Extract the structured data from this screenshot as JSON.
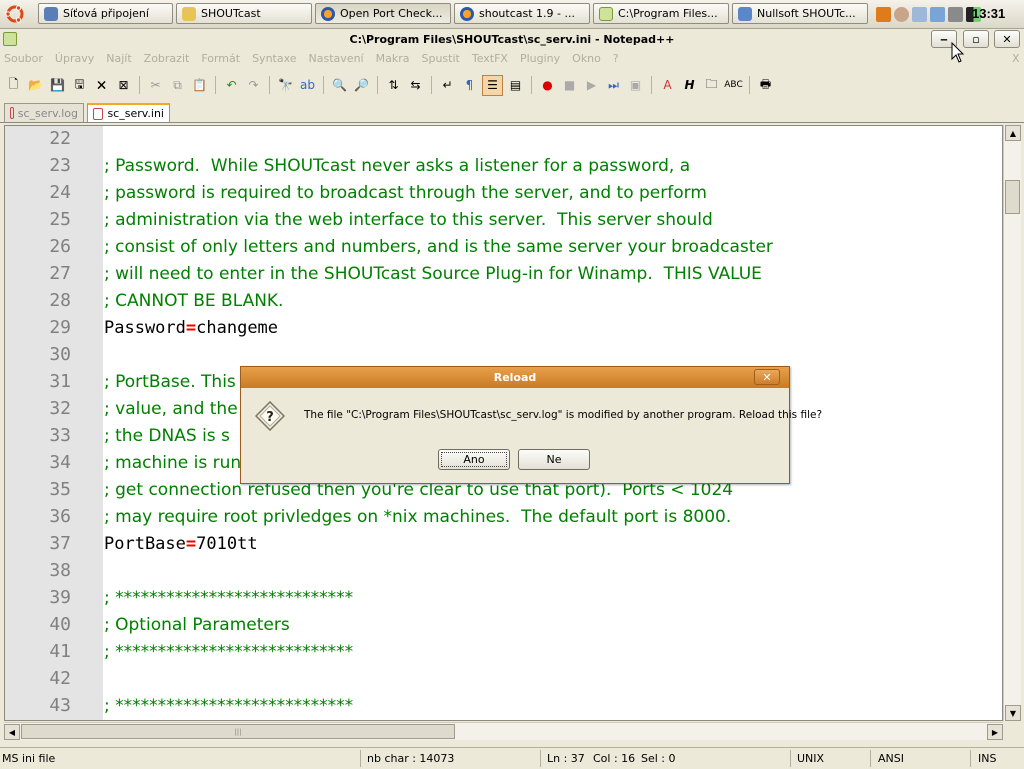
{
  "taskbar": {
    "items": [
      {
        "label": "Síťová připojení"
      },
      {
        "label": "SHOUTcast"
      },
      {
        "label": "Open Port Check..."
      },
      {
        "label": "shoutcast 1.9 - ..."
      },
      {
        "label": "C:\\Program Files..."
      },
      {
        "label": "Nullsoft SHOUTc..."
      }
    ],
    "clock": "13:31"
  },
  "window": {
    "title": "C:\\Program Files\\SHOUTcast\\sc_serv.ini - Notepad++",
    "minimize": "‒",
    "maximize": "▫",
    "close": "✕"
  },
  "menu": {
    "items": [
      "Soubor",
      "Úpravy",
      "Najít",
      "Zobrazit",
      "Formát",
      "Syntaxe",
      "Nastavení",
      "Makra",
      "Spustit",
      "TextFX",
      "Pluginy",
      "Okno",
      "?"
    ],
    "close": "X"
  },
  "tabs": [
    {
      "label": "sc_serv.log"
    },
    {
      "label": "sc_serv.ini"
    }
  ],
  "editor": {
    "lines": [
      {
        "n": "22",
        "text": ""
      },
      {
        "n": "23",
        "text": "; Password.  While SHOUTcast never asks a listener for a password, a"
      },
      {
        "n": "24",
        "text": "; password is required to broadcast through the server, and to perform"
      },
      {
        "n": "25",
        "text": "; administration via the web interface to this server.  This server should"
      },
      {
        "n": "26",
        "text": "; consist of only letters and numbers, and is the same server your broadcaster"
      },
      {
        "n": "27",
        "text": "; will need to enter in the SHOUTcast Source Plug-in for Winamp.  THIS VALUE"
      },
      {
        "n": "28",
        "text": "; CANNOT BE BLANK."
      },
      {
        "n": "29",
        "key": "Password",
        "eq": "=",
        "value": "changeme"
      },
      {
        "n": "30",
        "text": ""
      },
      {
        "n": "31",
        "text": "; PortBase. This"
      },
      {
        "n": "32",
        "text": "; value, and the"
      },
      {
        "n": "33",
        "text": "; the DNAS is s"
      },
      {
        "n": "34",
        "text": "; machine is run"
      },
      {
        "n": "35",
        "text": "; get connection refused then you're clear to use that port).  Ports < 1024"
      },
      {
        "n": "36",
        "text": "; may require root privledges on *nix machines.  The default port is 8000."
      },
      {
        "n": "37",
        "key": "PortBase",
        "eq": "=",
        "value": "7010tt"
      },
      {
        "n": "38",
        "text": ""
      },
      {
        "n": "39",
        "text": "; ****************************"
      },
      {
        "n": "40",
        "text": "; Optional Parameters"
      },
      {
        "n": "41",
        "text": "; ****************************"
      },
      {
        "n": "42",
        "text": ""
      },
      {
        "n": "43",
        "text": "; ****************************"
      }
    ]
  },
  "status": {
    "file_type": "MS ini file",
    "nb_char": "nb char : 14073",
    "ln": "Ln : 37",
    "col": "Col : 16",
    "sel": "Sel : 0",
    "eol": "UNIX",
    "encoding": "ANSI",
    "mode": "INS"
  },
  "dialog": {
    "title": "Reload",
    "message": "The file \"C:\\Program Files\\SHOUTcast\\sc_serv.log\" is modified by another program. Reload this file?",
    "yes": "Ano",
    "no": "Ne",
    "close": "✕"
  },
  "colors": {
    "comment": "#008000",
    "operator": "#e00000",
    "dialog_title": "#d88a34"
  }
}
